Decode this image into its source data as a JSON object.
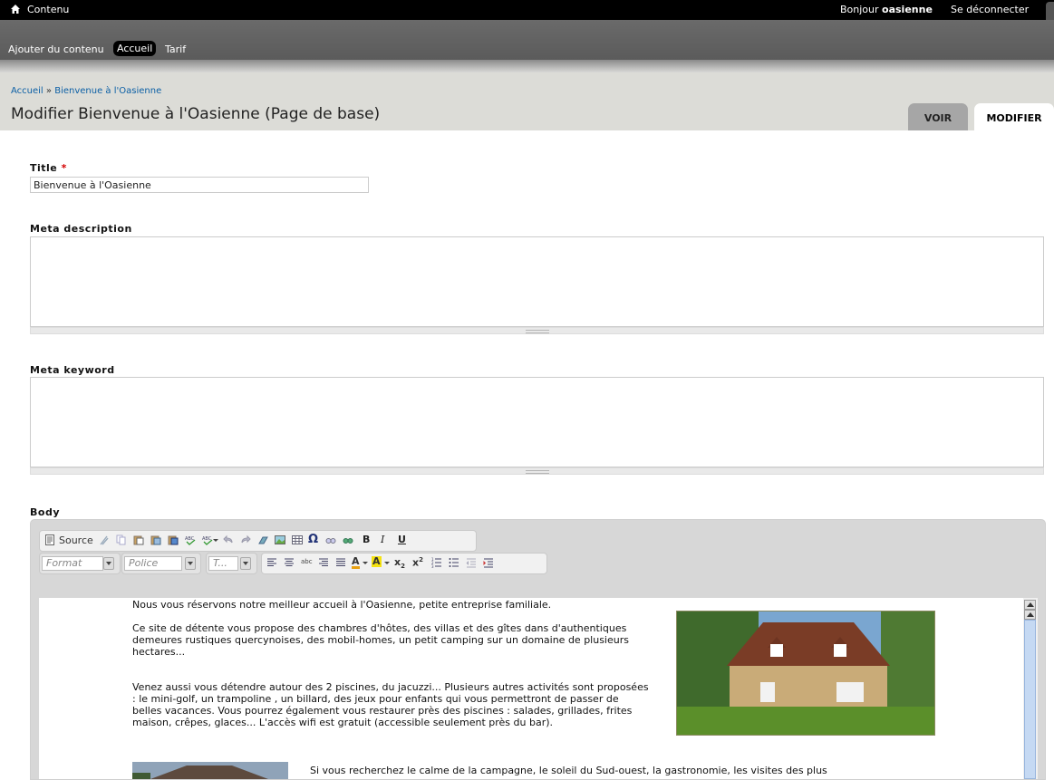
{
  "toolbar": {
    "menu_label": "Contenu",
    "greeting_prefix": "Bonjour",
    "username": "oasienne",
    "logout": "Se déconnecter"
  },
  "shortcuts": {
    "add_content": "Ajouter du contenu",
    "accueil": "Accueil",
    "tarif": "Tarif"
  },
  "breadcrumb": {
    "home": "Accueil",
    "separator": "»",
    "current": "Bienvenue à l'Oasienne"
  },
  "page_title": "Modifier Bienvenue à l'Oasienne (Page de base)",
  "tabs": {
    "view": "VOIR",
    "edit": "MODIFIER"
  },
  "form": {
    "title_label": "Title",
    "required_marker": "*",
    "title_value": "Bienvenue à l'Oasienne",
    "meta_description_label": "Meta description",
    "meta_description_value": "",
    "meta_keyword_label": "Meta keyword",
    "meta_keyword_value": "",
    "body_label": "Body"
  },
  "editor": {
    "source_label": "Source",
    "format_placeholder": "Format",
    "font_placeholder": "Police",
    "size_placeholder": "T...",
    "paragraphs": [
      "Nous vous réservons notre meilleur accueil à l'Oasienne, petite entreprise familiale.",
      "Ce site de détente vous propose des chambres d'hôtes, des villas et des gîtes dans d'authentiques demeures rustiques quercynoises, des mobil-homes, un petit camping sur un domaine de plusieurs hectares...",
      "Venez aussi vous détendre autour des 2 piscines, du jacuzzi... Plusieurs autres activités sont proposées : le mini-golf, un trampoline , un billard, des jeux pour enfants qui vous permettront de passer de belles vacances. Vous pourrez également vous restaurer près des piscines : salades, grillades, frites maison, crêpes, glaces... L'accès wifi est gratuit (accessible seulement près du bar).",
      "Si vous recherchez le calme de la campagne, le soleil du Sud-ouest, la gastronomie, les visites des plus"
    ]
  },
  "colors": {
    "toolbar_bg": "#000000",
    "shortcuts_bg": "#5e5e5e",
    "header_bg": "#dcdcd7",
    "link": "#0b5fa5",
    "required": "#d40000"
  }
}
